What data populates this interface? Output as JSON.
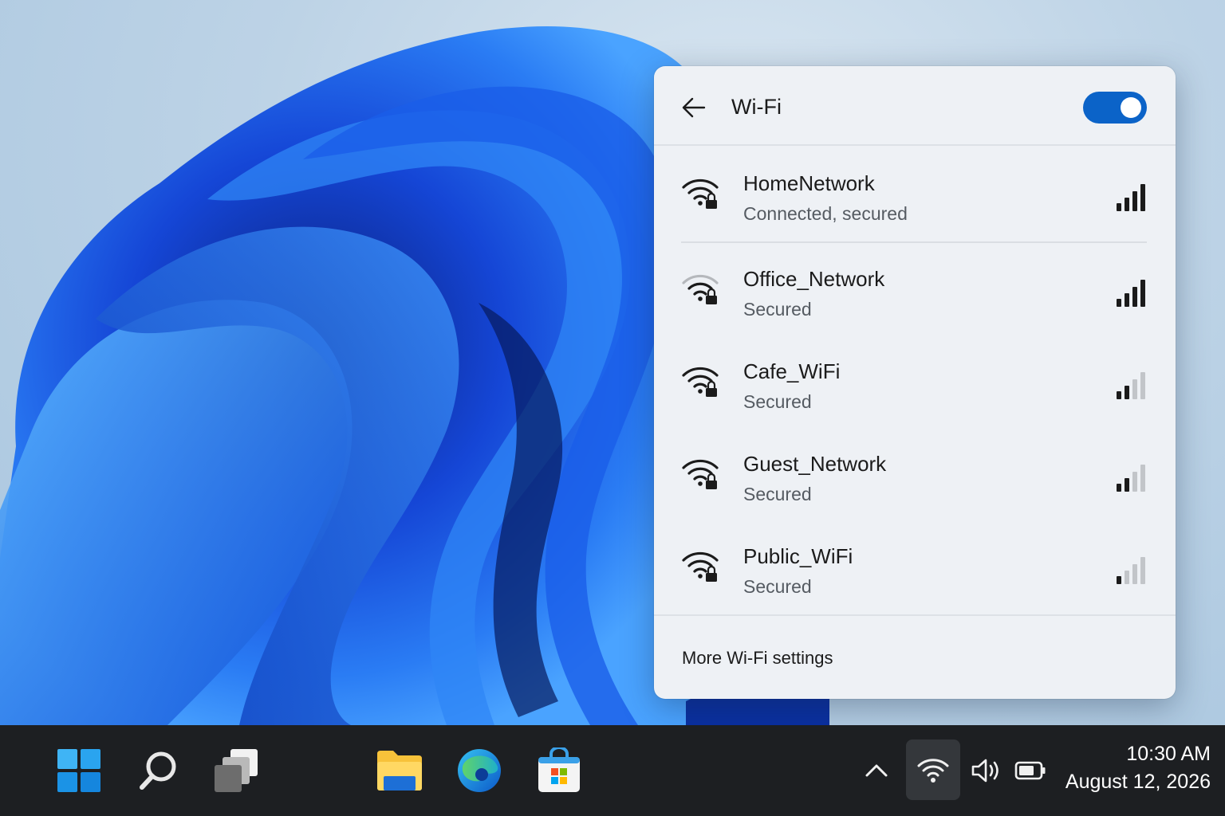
{
  "window": {
    "title": "Wi-Fi"
  },
  "wifi_panel": {
    "title": "Wi-Fi",
    "back_icon": "arrow-left-icon",
    "toggle_on": true,
    "networks": [
      {
        "name": "HomeNetwork",
        "status": "Connected, secured",
        "signal_level": 4,
        "icon": "wifi-lock-icon"
      },
      {
        "name": "Office_Network",
        "status": "Secured",
        "signal_level": 4,
        "icon": "wifi-lock-icon"
      },
      {
        "name": "Cafe_WiFi",
        "status": "Secured",
        "signal_level": 2,
        "icon": "wifi-lock-icon"
      },
      {
        "name": "Guest_Network",
        "status": "Secured",
        "signal_level": 2,
        "icon": "wifi-lock-icon"
      },
      {
        "name": "Public_WiFi",
        "status": "Secured",
        "signal_level": 1,
        "icon": "wifi-lock-icon"
      }
    ],
    "footer_link": "More Wi-Fi settings"
  },
  "taskbar": {
    "apps": [
      "start-icon",
      "search-icon",
      "task-view-icon",
      "file-explorer-icon",
      "edge-icon",
      "store-icon"
    ],
    "tray": [
      "chevron-up-icon",
      "wifi-icon",
      "volume-icon",
      "battery-icon"
    ],
    "clock": {
      "time": "10:30 AM",
      "date": "August 12, 2026"
    }
  },
  "colors": {
    "accent": "#0b63c8",
    "taskbar": "#1d1f22",
    "panel": "#eef1f5"
  }
}
